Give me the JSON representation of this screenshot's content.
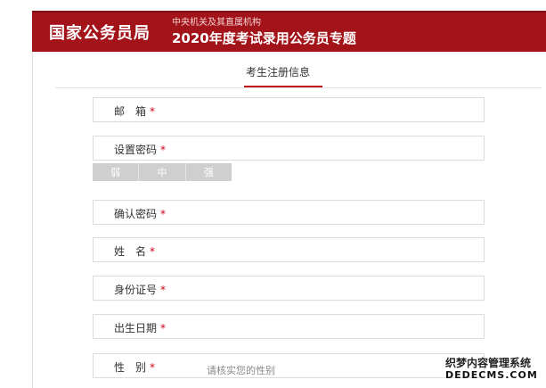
{
  "header": {
    "brand": "国家公务员局",
    "subtitle": "中央机关及其直属机构",
    "title": "2020年度考试录用公务员专题"
  },
  "section": {
    "tab_label": "考生注册信息"
  },
  "form": {
    "required_mark": "*",
    "fields": [
      {
        "label": "邮　箱"
      },
      {
        "label": "设置密码"
      },
      {
        "label": "确认密码"
      },
      {
        "label": "姓　名"
      },
      {
        "label": "身份证号"
      },
      {
        "label": "出生日期"
      },
      {
        "label": "性　别",
        "hint": "请核实您的性别"
      }
    ],
    "strength": [
      "弱",
      "中",
      "强"
    ]
  },
  "watermark": {
    "line1": "织梦内容管理系统",
    "line2": "DEDECMS.COM"
  },
  "colors": {
    "header_bg": "#a3141a",
    "accent": "#c0141b",
    "required": "#d0021b"
  }
}
